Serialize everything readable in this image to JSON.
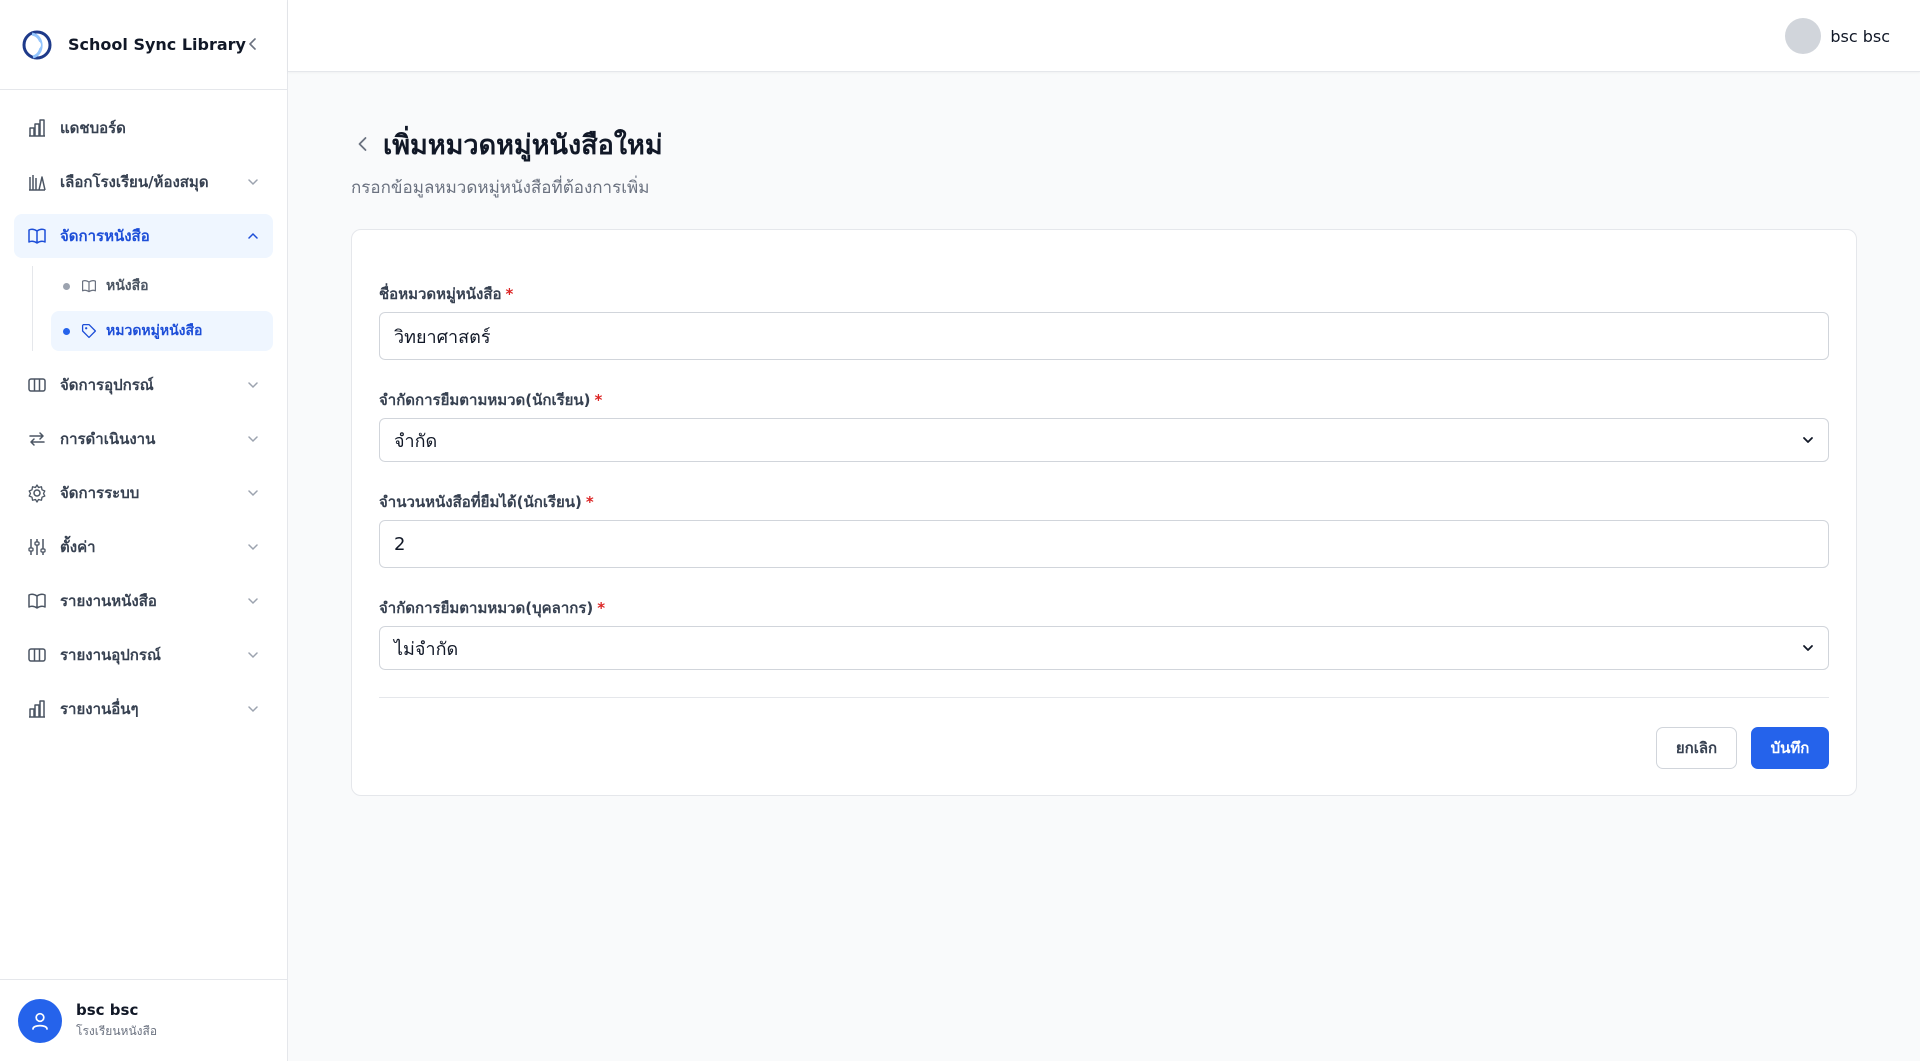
{
  "app": {
    "name": "School Sync Library"
  },
  "sidebar": {
    "items": [
      {
        "label": "แดชบอร์ด"
      },
      {
        "label": "เลือกโรงเรียน/ห้องสมุด"
      },
      {
        "label": "จัดการหนังสือ",
        "subitems": [
          {
            "label": "หนังสือ"
          },
          {
            "label": "หมวดหมู่หนังสือ"
          }
        ]
      },
      {
        "label": "จัดการอุปกรณ์"
      },
      {
        "label": "การดำเนินงาน"
      },
      {
        "label": "จัดการระบบ"
      },
      {
        "label": "ตั้งค่า"
      },
      {
        "label": "รายงานหนังสือ"
      },
      {
        "label": "รายงานอุปกรณ์"
      },
      {
        "label": "รายงานอื่นๆ"
      }
    ],
    "footer": {
      "name": "bsc bsc",
      "org": "โรงเรียนหนังสือ"
    }
  },
  "header": {
    "user_name": "bsc bsc"
  },
  "page": {
    "title": "เพิ่มหมวดหมู่หนังสือใหม่",
    "subtitle": "กรอกข้อมูลหมวดหมู่หนังสือที่ต้องการเพิ่ม"
  },
  "form": {
    "category_name": {
      "label": "ชื่อหมวดหมู่หนังสือ",
      "required": "*",
      "value": "วิทยาศาสตร์"
    },
    "student_limit": {
      "label": "จำกัดการยืมตามหมวด(นักเรียน)",
      "required": "*",
      "value": "จำกัด"
    },
    "student_quota": {
      "label": "จำนวนหนังสือที่ยืมได้(นักเรียน)",
      "required": "*",
      "value": "2"
    },
    "staff_limit": {
      "label": "จำกัดการยืมตามหมวด(บุคลากร)",
      "required": "*",
      "value": "ไม่จำกัด"
    },
    "cancel_label": "ยกเลิก",
    "save_label": "บันทึก"
  },
  "colors": {
    "accent": "#2563eb",
    "active_bg": "#eff6ff",
    "required": "#dc2626"
  },
  "icons": [
    "app-logo-icon",
    "chevron-left-icon",
    "bar-chart-icon",
    "library-icon",
    "book-open-icon",
    "tag-icon",
    "columns-icon",
    "arrows-swap-icon",
    "gear-icon",
    "sliders-icon",
    "chevron-down-icon",
    "chevron-up-icon",
    "user-icon"
  ]
}
